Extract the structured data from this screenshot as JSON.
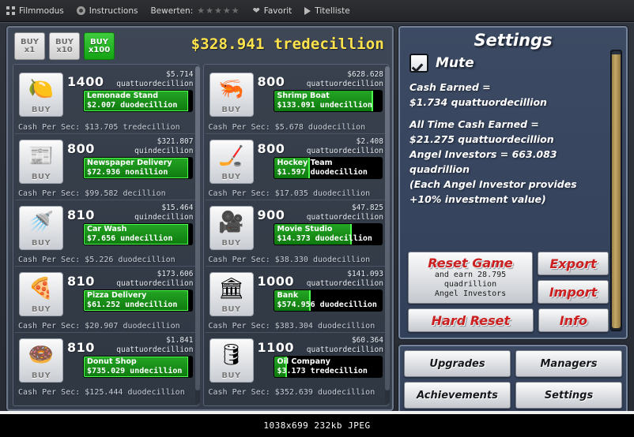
{
  "topbar": {
    "film_mode": "Filmmodus",
    "instructions": "Instructions",
    "rate_label": "Bewerten:",
    "stars": "★★★★★",
    "favorite": "Favorit",
    "title_list": "Titelliste"
  },
  "game": {
    "buy_buttons": [
      {
        "line1": "BUY",
        "line2": "x1",
        "active": false
      },
      {
        "line1": "BUY",
        "line2": "x10",
        "active": false
      },
      {
        "line1": "BUY",
        "line2": "x100",
        "active": true
      }
    ],
    "total_cash": "$328.941 tredecillion",
    "buy_label": "BUY",
    "cps_prefix": "Cash Per Sec: ",
    "businesses_left": [
      {
        "icon": "lemonade-icon",
        "glyph": "🍋",
        "qty": "1400",
        "cost_amount": "$5.714",
        "cost_unit": "quattuordecillion",
        "name": "Lemonade Stand",
        "value": "$2.007 duodecillion",
        "cps": "Cash Per Sec: $13.705 tredecillion",
        "progress": 97
      },
      {
        "icon": "newspaper-icon",
        "glyph": "📰",
        "qty": "800",
        "cost_amount": "$321.807",
        "cost_unit": "quindecillion",
        "name": "Newspaper Delivery",
        "value": "$72.936 nonillion",
        "cps": "Cash Per Sec: $99.582 decillion",
        "progress": 97
      },
      {
        "icon": "carwash-icon",
        "glyph": "🚿",
        "qty": "810",
        "cost_amount": "$15.464",
        "cost_unit": "quindecillion",
        "name": "Car Wash",
        "value": "$7.656 undecillion",
        "cps": "Cash Per Sec: $5.226 duodecillion",
        "progress": 97
      },
      {
        "icon": "pizza-icon",
        "glyph": "🍕",
        "qty": "810",
        "cost_amount": "$173.606",
        "cost_unit": "quattuordecillion",
        "name": "Pizza Delivery",
        "value": "$61.252 undecillion",
        "cps": "Cash Per Sec: $20.907 duodecillion",
        "progress": 97
      },
      {
        "icon": "donut-icon",
        "glyph": "🍩",
        "qty": "810",
        "cost_amount": "$1.841",
        "cost_unit": "quattuordecillion",
        "name": "Donut Shop",
        "value": "$735.029 undecillion",
        "cps": "Cash Per Sec: $125.444 duodecillion",
        "progress": 97
      }
    ],
    "businesses_right": [
      {
        "icon": "shrimp-icon",
        "glyph": "🦐",
        "qty": "800",
        "cost_amount": "$628.628",
        "cost_unit": "quattuordecillion",
        "name": "Shrimp Boat",
        "value": "$133.091 undecillion",
        "cps": "Cash Per Sec: $5.678 duodecillion",
        "progress": 92
      },
      {
        "icon": "hockey-icon",
        "glyph": "🏒",
        "qty": "800",
        "cost_amount": "$2.408",
        "cost_unit": "quattuordecillion",
        "name": "Hockey Team",
        "value": "$1.597 duodecillion",
        "cps": "Cash Per Sec: $17.035 duodecillion",
        "progress": 33
      },
      {
        "icon": "movie-camera-icon",
        "glyph": "🎥",
        "qty": "900",
        "cost_amount": "$47.825",
        "cost_unit": "quattuordecillion",
        "name": "Movie Studio",
        "value": "$14.373 duodecillion",
        "cps": "Cash Per Sec: $38.330 duodecillion",
        "progress": 72
      },
      {
        "icon": "bank-icon",
        "glyph": "🏛",
        "qty": "1000",
        "cost_amount": "$141.093",
        "cost_unit": "quattuordecillion",
        "name": "Bank",
        "value": "$574.956 duodecillion",
        "cps": "Cash Per Sec: $383.304 duodecillion",
        "progress": 34
      },
      {
        "icon": "oil-pump-icon",
        "glyph": "🛢",
        "qty": "1100",
        "cost_amount": "$60.364",
        "cost_unit": "quattuordecillion",
        "name": "Oil Company",
        "value": "$3.173 tredecillion",
        "cps": "Cash Per Sec: $352.639 duodecillion",
        "progress": 12
      }
    ]
  },
  "settings": {
    "title": "Settings",
    "mute_label": "Mute",
    "cash_earned_label": "Cash Earned =",
    "cash_earned_value": "$1.734 quattuordecillion",
    "all_time_label": "All Time Cash Earned =",
    "all_time_value": "$21.275 quattuordecillion",
    "angel_line1": "Angel Investors = 663.083",
    "angel_line2": "quadrillion",
    "angel_note1": "(Each Angel Investor provides",
    "angel_note2": "+10% investment value)",
    "reset_title": "Reset Game",
    "reset_sub1": "and earn 28.795",
    "reset_sub2": "quadrillion",
    "reset_sub3": "Angel Investors",
    "export_label": "Export",
    "import_label": "Import",
    "hard_reset_label": "Hard Reset",
    "info_label": "Info"
  },
  "nav": {
    "upgrades": "Upgrades",
    "managers": "Managers",
    "achievements": "Achievements",
    "settings": "Settings"
  },
  "status": {
    "image_info": "1038x699 232kb JPEG"
  },
  "colors": {
    "accent_cash": "#ffe34d",
    "progress_green": "#24a524",
    "buy_active": "#13a313",
    "reset_red": "#cc1f1f",
    "panel_blue": "#3c4a63"
  }
}
